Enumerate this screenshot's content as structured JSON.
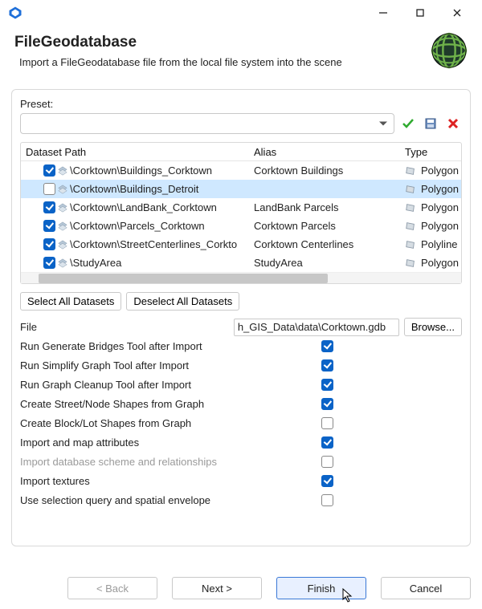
{
  "window": {
    "title": "FileGeodatabase",
    "subtitle": "Import a FileGeodatabase file from the local file system into the scene"
  },
  "preset": {
    "label": "Preset:",
    "value": ""
  },
  "table": {
    "headers": {
      "path": "Dataset Path",
      "alias": "Alias",
      "type": "Type"
    },
    "rows": [
      {
        "checked": true,
        "selected": false,
        "path": "\\Corktown\\Buildings_Corktown",
        "alias": "Corktown Buildings",
        "type": "Polygon"
      },
      {
        "checked": false,
        "selected": true,
        "path": "\\Corktown\\Buildings_Detroit",
        "alias": "",
        "type": "Polygon"
      },
      {
        "checked": true,
        "selected": false,
        "path": "\\Corktown\\LandBank_Corktown",
        "alias": "LandBank Parcels",
        "type": "Polygon"
      },
      {
        "checked": true,
        "selected": false,
        "path": "\\Corktown\\Parcels_Corktown",
        "alias": "Corktown Parcels",
        "type": "Polygon"
      },
      {
        "checked": true,
        "selected": false,
        "path": "\\Corktown\\StreetCenterlines_Corkto",
        "alias": "Corktown Centerlines",
        "type": "Polyline"
      },
      {
        "checked": true,
        "selected": false,
        "path": "\\StudyArea",
        "alias": "StudyArea",
        "type": "Polygon"
      }
    ]
  },
  "dataset_buttons": {
    "select_all": "Select All Datasets",
    "deselect_all": "Deselect All Datasets"
  },
  "file": {
    "label": "File",
    "value": "h_GIS_Data\\data\\Corktown.gdb",
    "browse": "Browse..."
  },
  "options": [
    {
      "label": "Run Generate Bridges Tool after Import",
      "checked": true,
      "disabled": false
    },
    {
      "label": "Run Simplify Graph Tool after Import",
      "checked": true,
      "disabled": false
    },
    {
      "label": "Run Graph Cleanup Tool after Import",
      "checked": true,
      "disabled": false
    },
    {
      "label": "Create Street/Node Shapes from Graph",
      "checked": true,
      "disabled": false
    },
    {
      "label": "Create Block/Lot Shapes from Graph",
      "checked": false,
      "disabled": false
    },
    {
      "label": "Import and map attributes",
      "checked": true,
      "disabled": false
    },
    {
      "label": "Import database scheme and relationships",
      "checked": false,
      "disabled": true
    },
    {
      "label": "Import textures",
      "checked": true,
      "disabled": false
    },
    {
      "label": "Use selection query and spatial envelope",
      "checked": false,
      "disabled": false
    }
  ],
  "footer": {
    "back": "< Back",
    "next": "Next >",
    "finish": "Finish",
    "cancel": "Cancel"
  }
}
